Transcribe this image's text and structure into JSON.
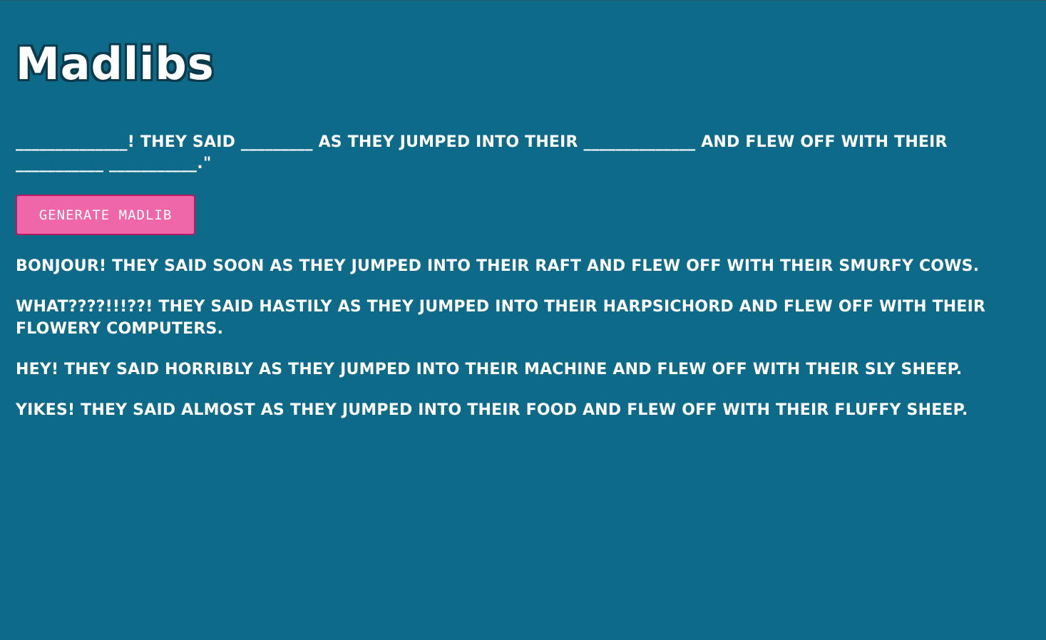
{
  "header": {
    "title": "Madlibs"
  },
  "template": {
    "text": "______________! They said _________ as they jumped into their ______________ and flew off with their ___________ ___________.\""
  },
  "actions": {
    "generate_label": "GENERATE MADLIB"
  },
  "results": [
    "Bonjour! They said soon as they jumped into their raft and flew off with their smurfy cows.",
    "What????!!!??! They said hastily as they jumped into their harpsichord and flew off with their flowery computers.",
    "Hey! They said horribly as they jumped into their machine and flew off with their sly sheep.",
    "Yikes! They said almost as they jumped into their food and flew off with their fluffy sheep."
  ],
  "colors": {
    "background": "#0d6a89",
    "button": "#ef67a8",
    "button_border": "#b51a62",
    "title_outline": "#0a3a4c",
    "text": "#ffffff"
  }
}
